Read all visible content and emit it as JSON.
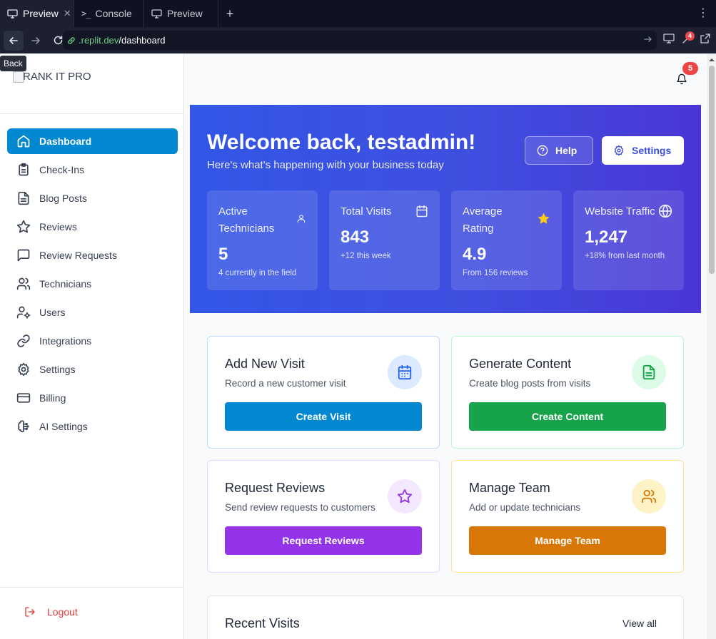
{
  "browser": {
    "tabs": [
      {
        "label": "Preview",
        "icon": "monitor-icon",
        "active": true
      },
      {
        "label": "Console",
        "icon": "terminal-icon",
        "active": false
      },
      {
        "label": "Preview",
        "icon": "monitor-icon",
        "active": false
      }
    ],
    "new_tab": "+",
    "url_host": ".replit.dev",
    "url_path": "/dashboard",
    "devtools_badge": "4",
    "tooltip": "Back"
  },
  "sidebar": {
    "brand": "RANK IT PRO",
    "items": [
      {
        "label": "Dashboard",
        "icon": "home-icon",
        "active": true
      },
      {
        "label": "Check-Ins",
        "icon": "clipboard-icon",
        "active": false
      },
      {
        "label": "Blog Posts",
        "icon": "document-icon",
        "active": false
      },
      {
        "label": "Reviews",
        "icon": "star-icon",
        "active": false
      },
      {
        "label": "Review Requests",
        "icon": "message-icon",
        "active": false
      },
      {
        "label": "Technicians",
        "icon": "users-icon",
        "active": false
      },
      {
        "label": "Users",
        "icon": "user-cog-icon",
        "active": false
      },
      {
        "label": "Integrations",
        "icon": "link-icon",
        "active": false
      },
      {
        "label": "Settings",
        "icon": "gear-icon",
        "active": false
      },
      {
        "label": "Billing",
        "icon": "credit-card-icon",
        "active": false
      },
      {
        "label": "AI Settings",
        "icon": "brain-icon",
        "active": false
      }
    ],
    "logout": "Logout"
  },
  "header": {
    "notification_count": "5"
  },
  "hero": {
    "title": "Welcome back, testadmin!",
    "subtitle": "Here's what's happening with your business today",
    "help_label": "Help",
    "settings_label": "Settings",
    "stats": [
      {
        "label": "Active Technicians",
        "value": "5",
        "sub": "4 currently in the field",
        "icon": "user-icon"
      },
      {
        "label": "Total Visits",
        "value": "843",
        "sub": "+12 this week",
        "icon": "calendar-icon"
      },
      {
        "label": "Average Rating",
        "value": "4.9",
        "sub": "From 156 reviews",
        "icon": "star-icon"
      },
      {
        "label": "Website Traffic",
        "value": "1,247",
        "sub": "+18% from last month",
        "icon": "globe-icon"
      }
    ]
  },
  "actions": [
    {
      "title": "Add New Visit",
      "subtitle": "Record a new customer visit",
      "button": "Create Visit",
      "icon": "calendar-icon",
      "accent": "#0288d1",
      "tint": "#dbeafe",
      "border": "#bfdbfe"
    },
    {
      "title": "Generate Content",
      "subtitle": "Create blog posts from visits",
      "button": "Create Content",
      "icon": "document-icon",
      "accent": "#16a34a",
      "tint": "#dcfce7",
      "border": "#bbf7d0"
    },
    {
      "title": "Request Reviews",
      "subtitle": "Send review requests to customers",
      "button": "Request Reviews",
      "icon": "star-icon",
      "accent": "#9333ea",
      "tint": "#f3e8ff",
      "border": "#e9d5ff"
    },
    {
      "title": "Manage Team",
      "subtitle": "Add or update technicians",
      "button": "Manage Team",
      "icon": "users-icon",
      "accent": "#d97706",
      "tint": "#fef3c7",
      "border": "#fde68a"
    }
  ],
  "recent": {
    "title": "Recent Visits",
    "view_all": "View all"
  }
}
